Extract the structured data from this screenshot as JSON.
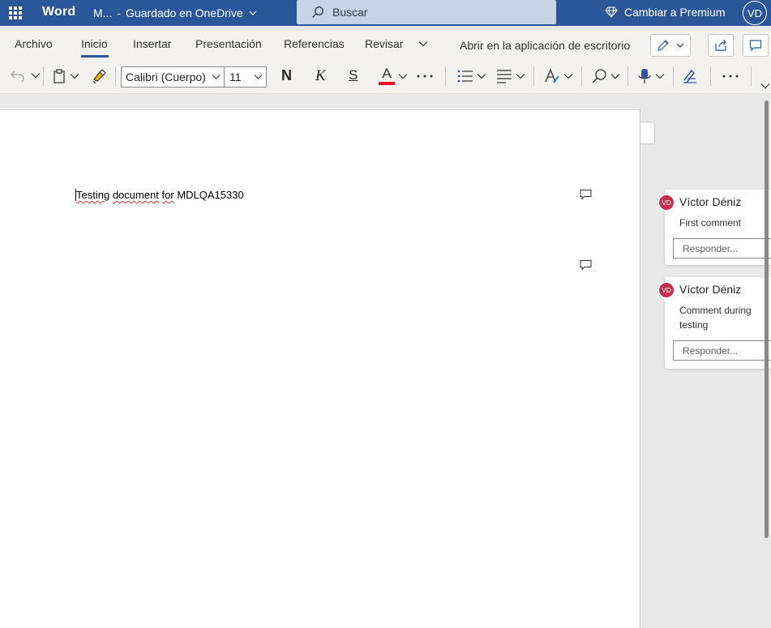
{
  "titlebar": {
    "app_name": "Word",
    "doc_name": "M...",
    "separator": "-",
    "save_status": "Guardado en OneDrive",
    "search_placeholder": "Buscar",
    "premium_label": "Cambiar a Premium",
    "user_initials": "VD",
    "bar_color": "#2b579a"
  },
  "menu": {
    "tabs": [
      "Archivo",
      "Inicio",
      "Insertar",
      "Presentación",
      "Referencias",
      "Revisar"
    ],
    "active_tab": "Inicio",
    "open_desktop_label": "Abrir en la aplicación de escritorio"
  },
  "toolbar": {
    "font_name": "Calibri (Cuerpo)",
    "font_size": "11",
    "bold_label": "N",
    "italic_label": "K",
    "underline_label": "S",
    "font_color_label": "A",
    "font_color": "#e81123",
    "icons": [
      "undo-icon",
      "paste-icon",
      "format-painter-icon",
      "more-icon",
      "bullets-icon",
      "align-icon",
      "styles-icon",
      "find-icon",
      "dictate-icon",
      "editor-icon",
      "more-icon",
      "expand-ribbon-icon"
    ]
  },
  "document": {
    "text_before": "Testing",
    "text_spell": "document",
    "text_mid": " ",
    "text_spell2": "for",
    "text_after": " MDLQA15330"
  },
  "comments": [
    {
      "initials": "VD",
      "author": "Víctor Déniz",
      "text": "First comment",
      "reply_placeholder": "Responder..."
    },
    {
      "initials": "VD",
      "author": "Víctor Déniz",
      "text": "Comment during testing",
      "reply_placeholder": "Responder..."
    }
  ],
  "colors": {
    "avatar_comment": "#c4314b",
    "accent": "#2b579a"
  }
}
